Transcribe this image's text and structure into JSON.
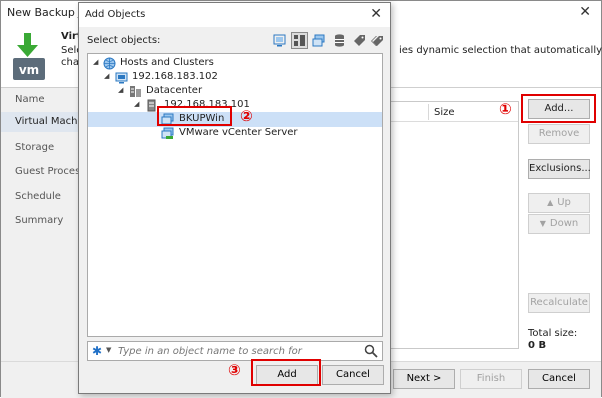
{
  "wizard": {
    "title": "New Backup Job",
    "heading": "Virt",
    "description_line1": "Sele",
    "description_line1_right": "ies dynamic selection that automatically",
    "description_line2": "cha",
    "nav": [
      {
        "label": "Name",
        "active": false
      },
      {
        "label": "Virtual Machin",
        "active": true
      },
      {
        "label": "Storage",
        "active": false
      },
      {
        "label": "Guest Processi",
        "active": false
      },
      {
        "label": "Schedule",
        "active": false
      },
      {
        "label": "Summary",
        "active": false
      }
    ],
    "table": {
      "columns": [
        "Size"
      ]
    },
    "buttons": {
      "add": "Add...",
      "remove": "Remove",
      "exclusions": "Exclusions...",
      "up": "Up",
      "down": "Down",
      "recalculate": "Recalculate"
    },
    "total_size_label": "Total size:",
    "total_size_value": "0 B",
    "footer": {
      "next": "Next >",
      "finish": "Finish",
      "cancel": "Cancel"
    }
  },
  "dialog": {
    "title": "Add Objects",
    "select_label": "Select objects:",
    "view_icons": [
      "host-icon",
      "cluster-view-icon",
      "vm-folder-icon",
      "datastore-icon",
      "tag-icon",
      "tags-icon"
    ],
    "tree": [
      {
        "label": "Hosts and Clusters",
        "level": 0,
        "expanded": true,
        "icon": "globe-icon"
      },
      {
        "label": "192.168.183.102",
        "level": 1,
        "expanded": true,
        "icon": "vcenter-icon"
      },
      {
        "label": "Datacenter",
        "level": 2,
        "expanded": true,
        "icon": "datacenter-icon"
      },
      {
        "label": "192.168.183.101",
        "level": 3,
        "expanded": true,
        "icon": "server-icon"
      },
      {
        "label": "BKUPWin",
        "level": 4,
        "selected": true,
        "icon": "vm-icon"
      },
      {
        "label": "VMware vCenter Server",
        "level": 4,
        "icon": "vm-icon"
      }
    ],
    "search": {
      "placeholder": "Type in an object name to search for"
    },
    "buttons": {
      "add": "Add",
      "cancel": "Cancel"
    }
  },
  "annotations": [
    "①",
    "②",
    "③"
  ],
  "colors": {
    "highlight": "#e00000",
    "selection": "#cce0f7",
    "accent": "#1f6fc6",
    "logo_green": "#3aa935"
  }
}
